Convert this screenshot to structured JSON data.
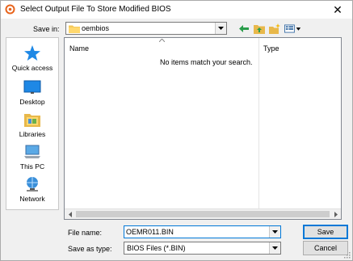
{
  "window": {
    "title": "Select Output File To Store Modified BIOS",
    "close_glyph": "✕",
    "accent_color": "#0078d7"
  },
  "save_in": {
    "label": "Save in:",
    "value": "oembios"
  },
  "toolbar": {
    "icons": [
      "back-icon",
      "up-folder-icon",
      "new-folder-icon",
      "view-menu-icon"
    ]
  },
  "places": [
    {
      "label": "Quick access",
      "icon": "star-icon"
    },
    {
      "label": "Desktop",
      "icon": "desktop-icon"
    },
    {
      "label": "Libraries",
      "icon": "libraries-icon"
    },
    {
      "label": "This PC",
      "icon": "computer-icon"
    },
    {
      "label": "Network",
      "icon": "network-icon"
    }
  ],
  "file_list": {
    "columns": [
      "Name",
      "Type"
    ],
    "empty_message": "No items match your search."
  },
  "file_name": {
    "label": "File name:",
    "value": "OEMR011.BIN"
  },
  "save_as_type": {
    "label": "Save as type:",
    "value": "BIOS Files (*.BIN)"
  },
  "buttons": {
    "save": "Save",
    "cancel": "Cancel"
  }
}
